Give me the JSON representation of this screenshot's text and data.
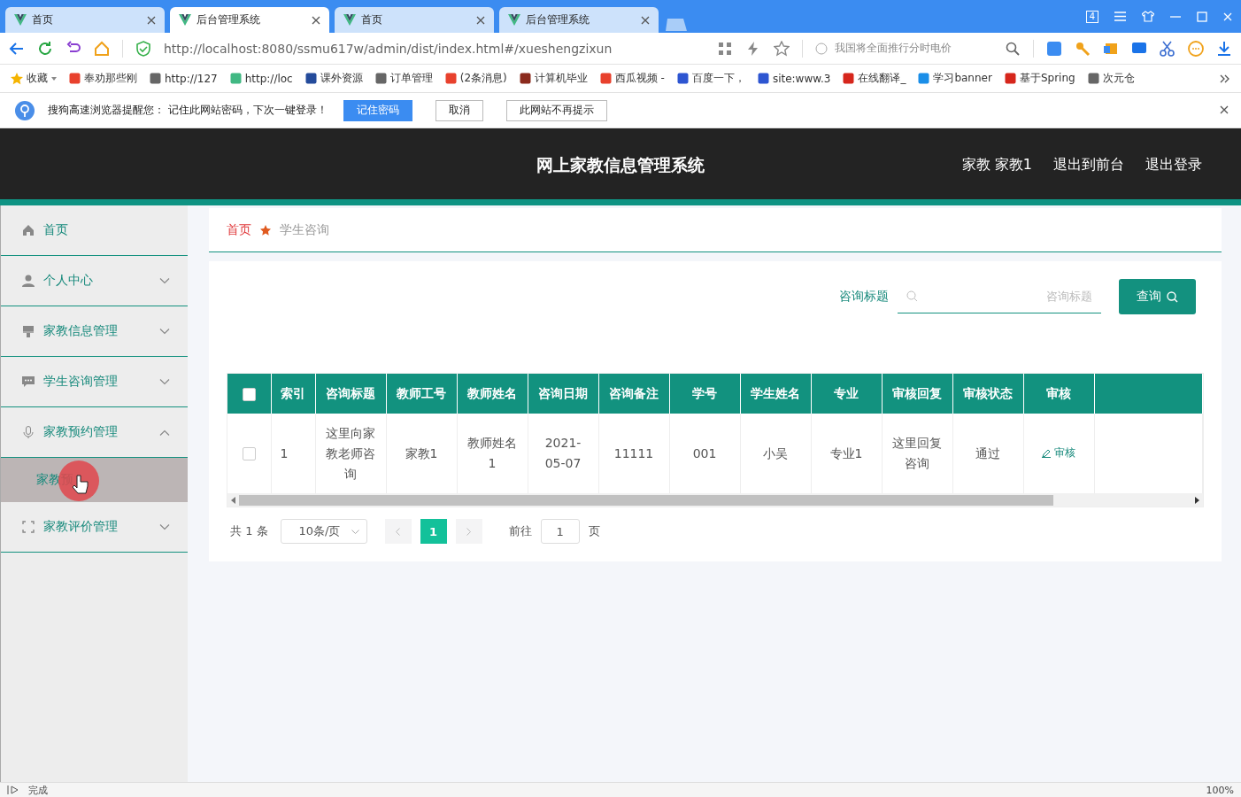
{
  "browser": {
    "tabs": [
      {
        "label": "首页",
        "selected": false
      },
      {
        "label": "后台管理系统",
        "selected": true
      },
      {
        "label": "首页",
        "selected": false
      },
      {
        "label": "后台管理系统",
        "selected": false
      }
    ],
    "window_badge": "4",
    "url": "http://localhost:8080/ssmu617w/admin/dist/index.html#/xueshengzixun",
    "search_placeholder": "我国将全面推行分时电价",
    "favorites": "收藏",
    "bookmarks": [
      "奉劝那些刚",
      "http://127",
      "http://loc",
      "课外资源",
      "订单管理",
      "(2条消息)",
      "计算机毕业",
      "西瓜视频 -",
      "百度一下，",
      "site:www.3",
      "在线翻译_",
      "学习banner",
      "基于Spring",
      "次元仓"
    ],
    "notice": {
      "text": "搜狗高速浏览器提醒您： 记住此网站密码，下次一键登录！",
      "buttons": [
        {
          "label": "记住密码",
          "kind": "primary"
        },
        {
          "label": "取消",
          "kind": "plain"
        },
        {
          "label": "此网站不再提示",
          "kind": "plain"
        }
      ]
    }
  },
  "app": {
    "title": "网上家教信息管理系统",
    "header_links": [
      "家教 家教1",
      "退出到前台",
      "退出登录"
    ],
    "sidebar": [
      {
        "label": "首页",
        "kind": "link"
      },
      {
        "label": "个人中心",
        "kind": "group",
        "expanded": false
      },
      {
        "label": "家教信息管理",
        "kind": "group",
        "expanded": false
      },
      {
        "label": "学生咨询管理",
        "kind": "group",
        "expanded": false
      },
      {
        "label": "家教预约管理",
        "kind": "group",
        "expanded": true,
        "children": [
          {
            "label": "家教预",
            "selected": true
          }
        ]
      },
      {
        "label": "家教评价管理",
        "kind": "group",
        "expanded": false
      }
    ],
    "breadcrumb": [
      "首页",
      "学生咨询"
    ],
    "search": {
      "label": "咨询标题",
      "placeholder": "咨询标题",
      "button": "查询"
    },
    "table": {
      "all_checked": false,
      "columns": [
        "索引",
        "咨询标题",
        "教师工号",
        "教师姓名",
        "咨询日期",
        "咨询备注",
        "学号",
        "学生姓名",
        "专业",
        "审核回复",
        "审核状态",
        "审核"
      ],
      "rows": [
        {
          "checked": false,
          "cells": [
            "1",
            "这里向家教老师咨询",
            "家教1",
            "教师姓名1",
            "2021-05-07",
            "11111",
            "001",
            "小吴",
            "专业1",
            "这里回复咨询",
            "通过"
          ],
          "action": "审核"
        }
      ]
    },
    "pagination": {
      "total": "共 1 条",
      "page_size": "10条/页",
      "pages": [
        {
          "label": "1",
          "selected": true
        }
      ],
      "goto_label": "前往",
      "goto_value": "1",
      "goto_unit": "页"
    }
  },
  "status_bar": {
    "text": "完成",
    "zoom": "100%"
  }
}
